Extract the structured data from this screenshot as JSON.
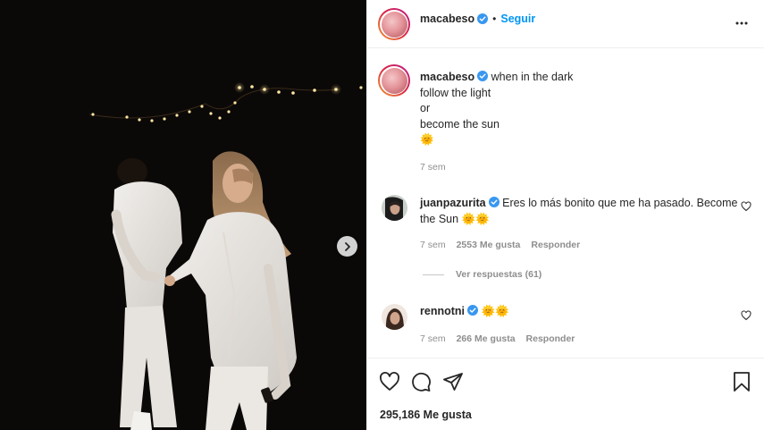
{
  "header": {
    "username": "macabeso",
    "separator": "•",
    "follow_label": "Seguir"
  },
  "caption": {
    "username": "macabeso",
    "lines": [
      "when in the dark",
      "follow the light",
      "or",
      "become the sun",
      "🌞"
    ],
    "time": "7 sem"
  },
  "comments": [
    {
      "username": "juanpazurita",
      "text": "Eres lo más bonito que me ha pasado. Become the Sun 🌞🌞",
      "time": "7 sem",
      "likes": "2553 Me gusta",
      "reply": "Responder",
      "view_replies": "Ver respuestas (61)"
    },
    {
      "username": "rennotni",
      "text": "🌞🌞",
      "time": "7 sem",
      "likes": "266 Me gusta",
      "reply": "Responder"
    }
  ],
  "footer": {
    "likes": "295,186 Me gusta"
  },
  "icons": {
    "like": "heart-outline-icon",
    "comment": "speech-bubble-icon",
    "share": "paper-plane-icon",
    "save": "bookmark-icon",
    "more": "three-dots-icon",
    "verified": "verified-badge-icon",
    "next": "chevron-right-icon"
  },
  "colors": {
    "accent": "#0095f6",
    "verified": "#3897f0",
    "muted": "#8e8e8e",
    "text": "#262626"
  }
}
